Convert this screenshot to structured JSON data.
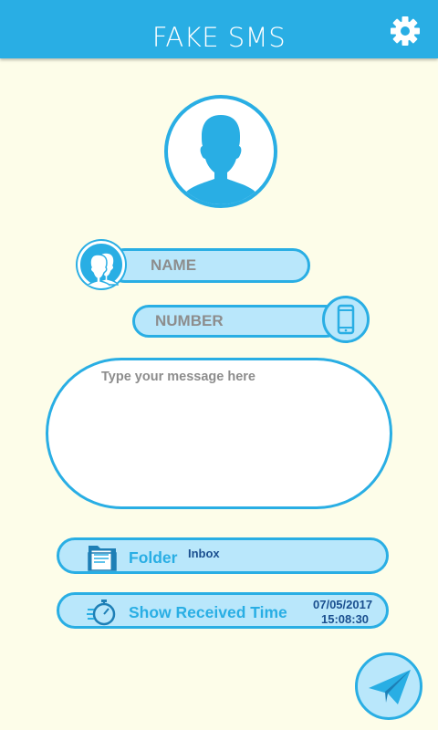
{
  "appbar": {
    "title": "FAKE SMS",
    "settings_icon": "gear-icon"
  },
  "colors": {
    "primary": "#29aee4",
    "light_fill": "#b9e7fb",
    "background": "#fdfde9",
    "value_text": "#1a4f8f"
  },
  "avatar": {
    "icon": "person-silhouette-icon"
  },
  "form": {
    "name": {
      "placeholder": "NAME",
      "value": "",
      "icon": "contacts-icon"
    },
    "number": {
      "placeholder": "NUMBER",
      "value": "",
      "icon": "smartphone-icon"
    },
    "message": {
      "placeholder": "Type your message here",
      "value": ""
    }
  },
  "folder": {
    "icon": "folder-icon",
    "label": "Folder",
    "value": "Inbox"
  },
  "received_time": {
    "icon": "stopwatch-icon",
    "label": "Show Received Time",
    "date": "07/05/2017",
    "time": "15:08:30"
  },
  "send": {
    "icon": "paper-plane-icon"
  }
}
